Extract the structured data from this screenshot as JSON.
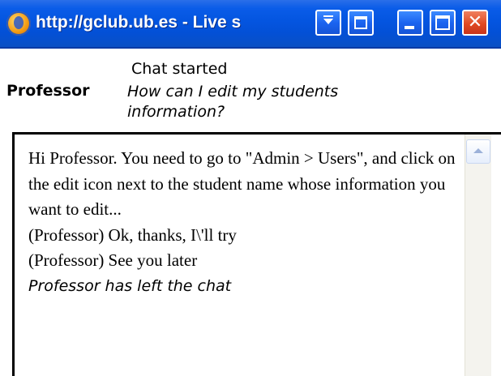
{
  "window": {
    "title": "http://gclub.ub.es - Live s",
    "icons": {
      "app": "browser-globe-icon",
      "menu": "menu-dropdown-icon",
      "restore": "restore-icon",
      "minimize": "minimize-icon",
      "maximize": "maximize-icon",
      "close": "close-icon"
    },
    "close_label": "✕"
  },
  "chat": {
    "status": "Chat started",
    "speaker": "Professor",
    "question": "How can I edit my students information?",
    "transcript": [
      "Hi Professor. You need to go to \"Admin > Users\", and click on the edit icon next to the student name whose information you want to edit...",
      "(Professor) Ok, thanks, I\\'ll try",
      "(Professor) See you later"
    ],
    "system_message": "Professor has left the chat"
  },
  "colors": {
    "titlebar": "#0455e0",
    "close_button": "#e04a22",
    "background": "#ffffff"
  }
}
